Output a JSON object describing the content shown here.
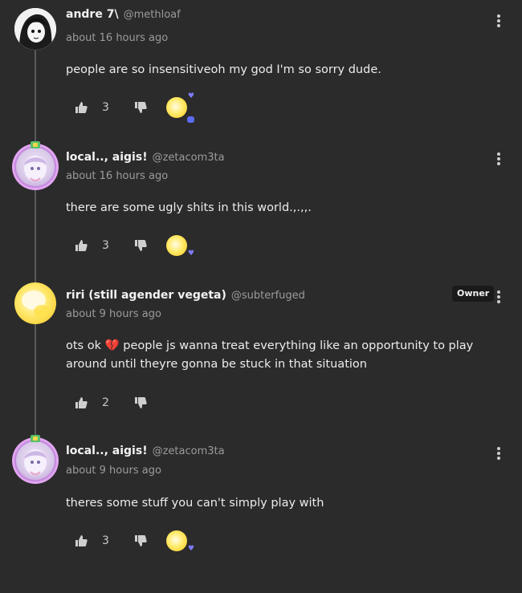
{
  "comments": [
    {
      "display_name": "andre 7\\",
      "handle": "@methloaf",
      "time": "about 16 hours ago",
      "text": "people are so insensitiveoh my god I'm so sorry dude.",
      "score": "3"
    },
    {
      "display_name": "local.., aigis!",
      "handle": "@zetacom3ta",
      "time": "about 16 hours ago",
      "text": "there are some ugly shits in this world.,.,,.",
      "score": "3"
    },
    {
      "display_name": "riri (still agender vegeta)",
      "handle": "@subterfuged",
      "time": "about 9 hours ago",
      "owner_label": "Owner",
      "text_before": "ots ok",
      "emoji": "💔",
      "text_after": " people js wanna treat everything like an opportunity to play around until theyre gonna be stuck in that situation",
      "score": "2"
    },
    {
      "display_name": "local.., aigis!",
      "handle": "@zetacom3ta",
      "time": "about 9 hours ago",
      "text": "theres some stuff you can't simply play with",
      "score": "3"
    }
  ],
  "icons": {
    "thumb_up": "thumbs-up-icon",
    "thumb_down": "thumbs-down-icon",
    "menu": "kebab-menu-icon"
  },
  "colors": {
    "background": "#2b2b2b",
    "reaction_accent": "#7f7bff",
    "owner_tag_bg": "#1a1a1a"
  }
}
